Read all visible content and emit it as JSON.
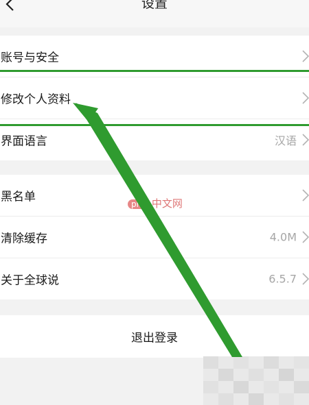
{
  "header": {
    "title": "设置"
  },
  "group1": [
    {
      "label": "账号与安全",
      "value": ""
    },
    {
      "label": "修改个人资料",
      "value": ""
    },
    {
      "label": "界面语言",
      "value": "汉语"
    }
  ],
  "group2": [
    {
      "label": "黑名单",
      "value": ""
    },
    {
      "label": "清除缓存",
      "value": "4.0M"
    },
    {
      "label": "关于全球说",
      "value": "6.5.7"
    }
  ],
  "logout": {
    "label": "退出登录"
  },
  "watermark": {
    "badge": "php",
    "text": "中文网"
  },
  "colors": {
    "highlight": "#2f9b2f",
    "value_text": "#a6a6a6",
    "background": "#f2f2f2"
  },
  "icons": {
    "back": "chevron-left-icon",
    "row": "chevron-right-icon"
  }
}
